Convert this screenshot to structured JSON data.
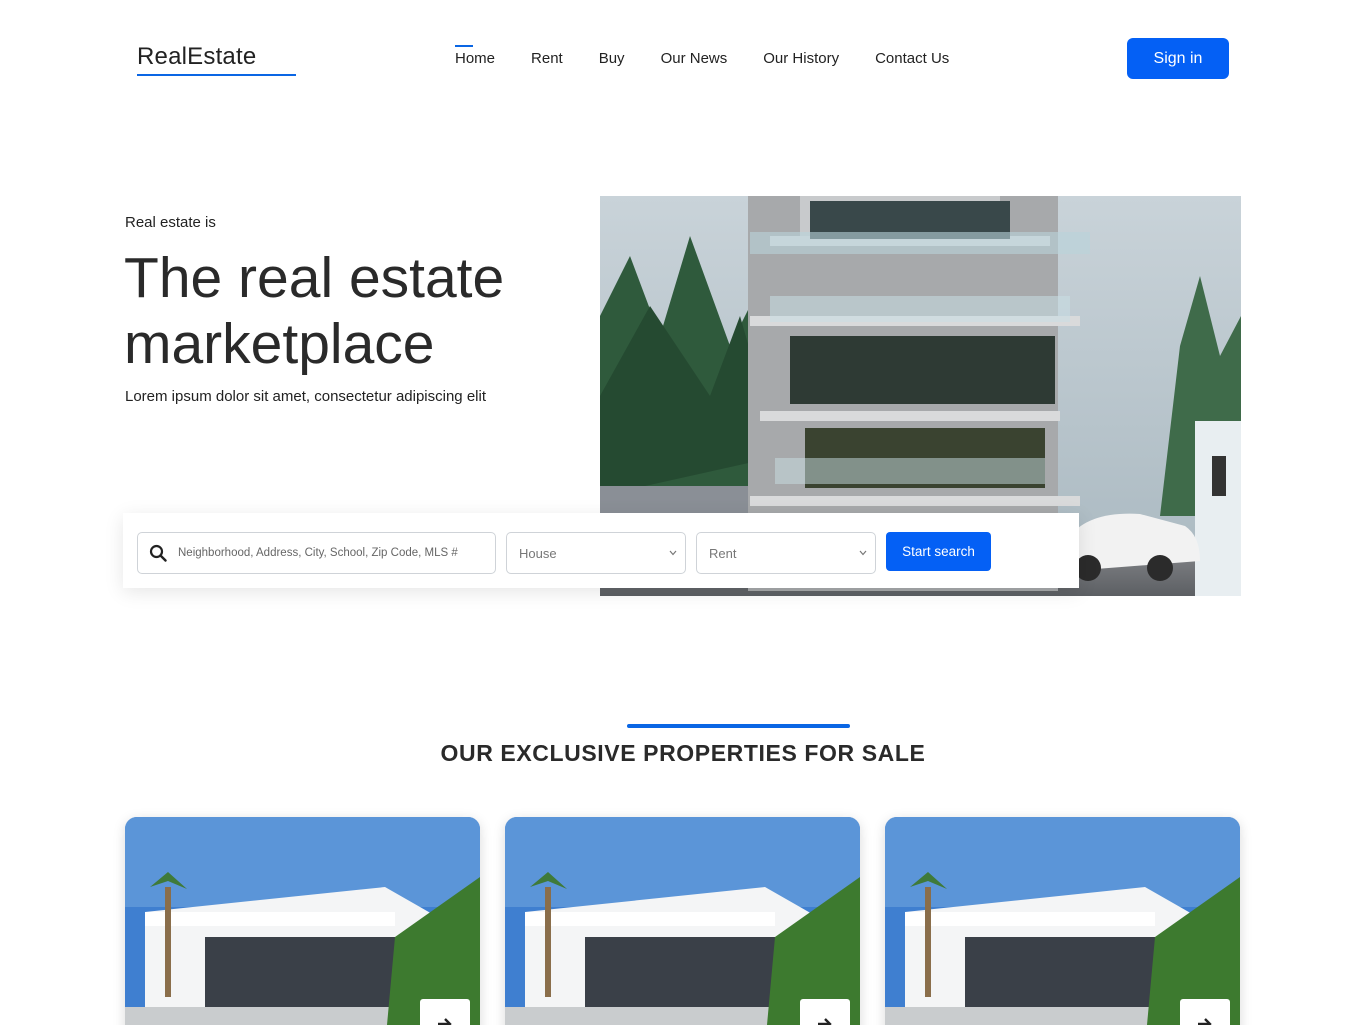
{
  "header": {
    "logo": "RealEstate",
    "nav": [
      {
        "label": "Home",
        "active": true
      },
      {
        "label": "Rent",
        "active": false
      },
      {
        "label": "Buy",
        "active": false
      },
      {
        "label": "Our News",
        "active": false
      },
      {
        "label": "Our History",
        "active": false
      },
      {
        "label": "Contact Us",
        "active": false
      }
    ],
    "signin_label": "Sign in"
  },
  "hero": {
    "eyebrow": "Real estate is",
    "title": "The real estate marketplace",
    "subtitle": "Lorem ipsum dolor sit amet, consectetur adipiscing elit"
  },
  "search": {
    "placeholder": "Neighborhood, Address, City, School, Zip Code, MLS #",
    "property_type": "House",
    "listing_type": "Rent",
    "button_label": "Start search"
  },
  "section": {
    "title": "OUR EXCLUSIVE PROPERTIES FOR SALE"
  },
  "colors": {
    "accent": "#0460f5",
    "text": "#222222"
  },
  "icons": {
    "search": "search-icon",
    "chevron": "chevron-down-icon",
    "arrow": "arrow-right-icon"
  }
}
